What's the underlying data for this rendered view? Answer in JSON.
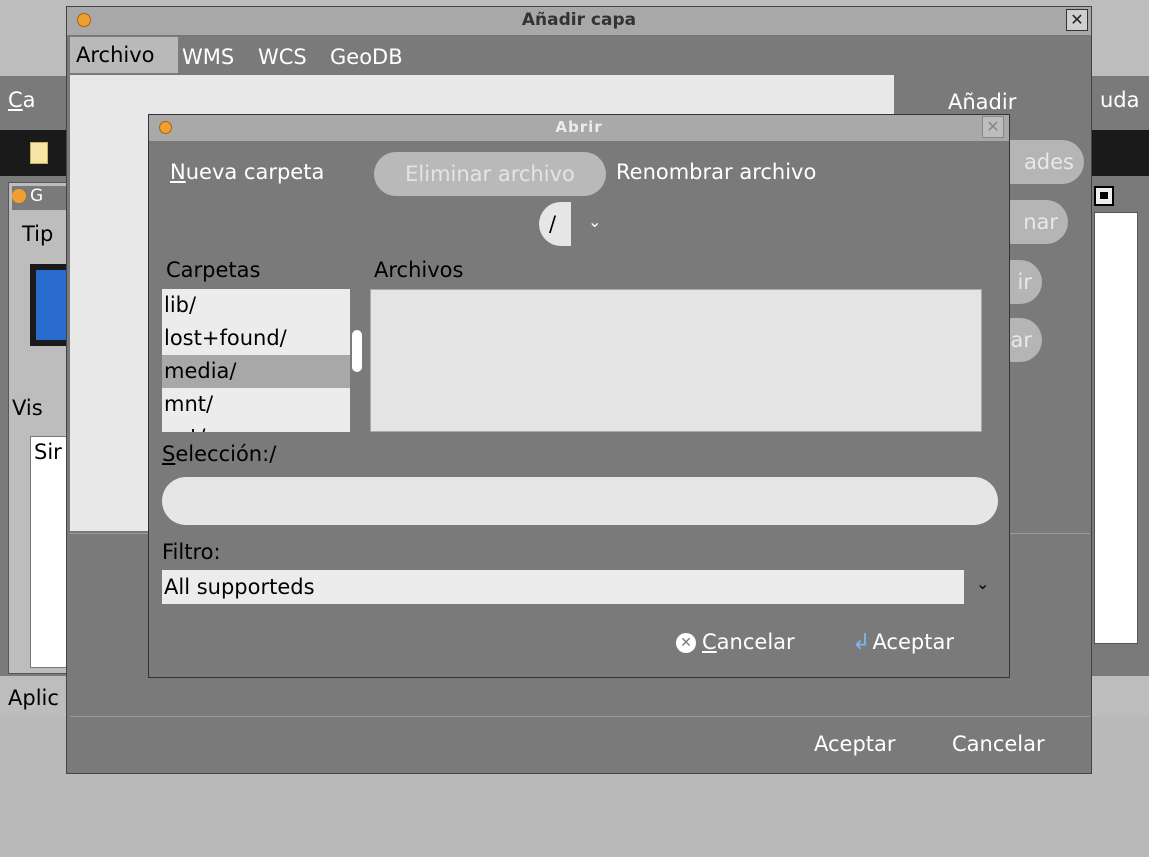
{
  "background": {
    "menu_left": "Ca",
    "menu_right": "uda",
    "panel_title": "G",
    "label_tipo": "Tip",
    "label_vis": "Vis",
    "label_sin": "Sir",
    "status_text": "Aplic"
  },
  "add_layer_dialog": {
    "title": "Añadir capa",
    "close_symbol": "✕",
    "tabs": [
      "Archivo",
      "WMS",
      "WCS",
      "GeoDB"
    ],
    "right_buttons": [
      "Añadir",
      "ades",
      "nar",
      "ir",
      "ar"
    ],
    "accept_label": "Aceptar",
    "cancel_label": "Cancelar"
  },
  "open_dialog": {
    "title": "Abrir",
    "close_symbol": "✕",
    "new_folder": "Nueva carpeta",
    "delete_file": "Eliminar archivo",
    "rename_file": "Renombrar archivo",
    "path": "/",
    "folders_label": "Carpetas",
    "files_label": "Archivos",
    "folders": [
      "lib/",
      "lost+found/",
      "media/",
      "mnt/",
      "opt/"
    ],
    "selected_folder_index": 2,
    "selection_label": "Selección:",
    "selection_value": "/",
    "filter_label": "Filtro:",
    "filter_value": "All supporteds",
    "cancel_label": "Cancelar",
    "accept_label": "Aceptar"
  },
  "colors": {
    "dialog_bg": "#7a7a7a",
    "accent_icon": "#7fb3ea",
    "title_dot": "#f0a030"
  }
}
